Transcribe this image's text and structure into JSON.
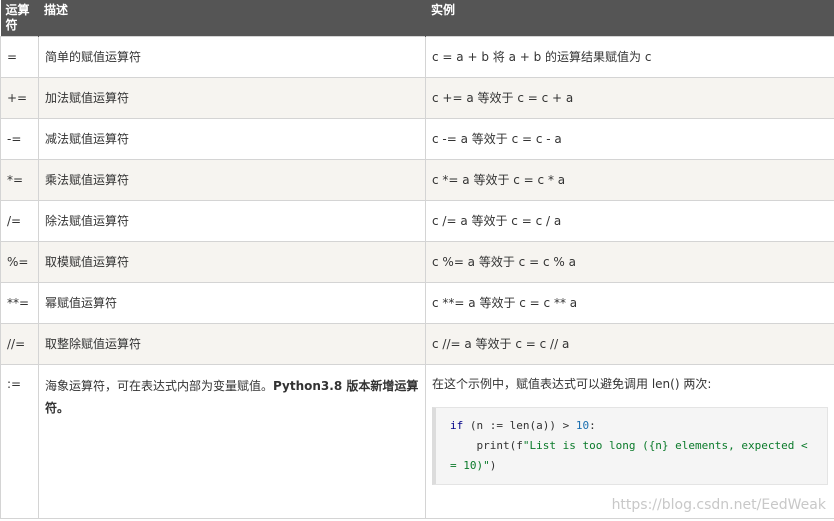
{
  "headers": [
    "运算符",
    "描述",
    "实例"
  ],
  "rows": [
    {
      "op": "=",
      "desc": "简单的赋值运算符",
      "example": "c = a + b 将 a + b 的运算结果赋值为 c"
    },
    {
      "op": "+=",
      "desc": "加法赋值运算符",
      "example": "c += a 等效于 c = c + a"
    },
    {
      "op": "-=",
      "desc": "减法赋值运算符",
      "example": "c -= a 等效于 c = c - a"
    },
    {
      "op": "*=",
      "desc": "乘法赋值运算符",
      "example": "c *= a 等效于 c = c * a"
    },
    {
      "op": "/=",
      "desc": "除法赋值运算符",
      "example": "c /= a 等效于 c = c / a"
    },
    {
      "op": "%=",
      "desc": "取模赋值运算符",
      "example": "c %= a 等效于 c = c % a"
    },
    {
      "op": "**=",
      "desc": "幂赋值运算符",
      "example": "c **= a 等效于 c = c ** a"
    },
    {
      "op": "//=",
      "desc": "取整除赋值运算符",
      "example": "c //= a 等效于 c = c // a"
    }
  ],
  "walrus": {
    "op": ":=",
    "desc": "海象运算符，可在表达式内部为变量赋值。",
    "desc_bold": "Python3.8 版本新增运算符。",
    "example_text": "在这个示例中，赋值表达式可以避免调用 len() 两次:",
    "code": {
      "if": "if",
      "cond": " (n := len(a)) > ",
      "ten": "10",
      "colon": ":",
      "indent": "    print(f",
      "fstring": "\"List is too long ({n} elements, expected < = 10)\"",
      "close": ")"
    }
  },
  "watermark": "https://blog.csdn.net/EedWeak"
}
